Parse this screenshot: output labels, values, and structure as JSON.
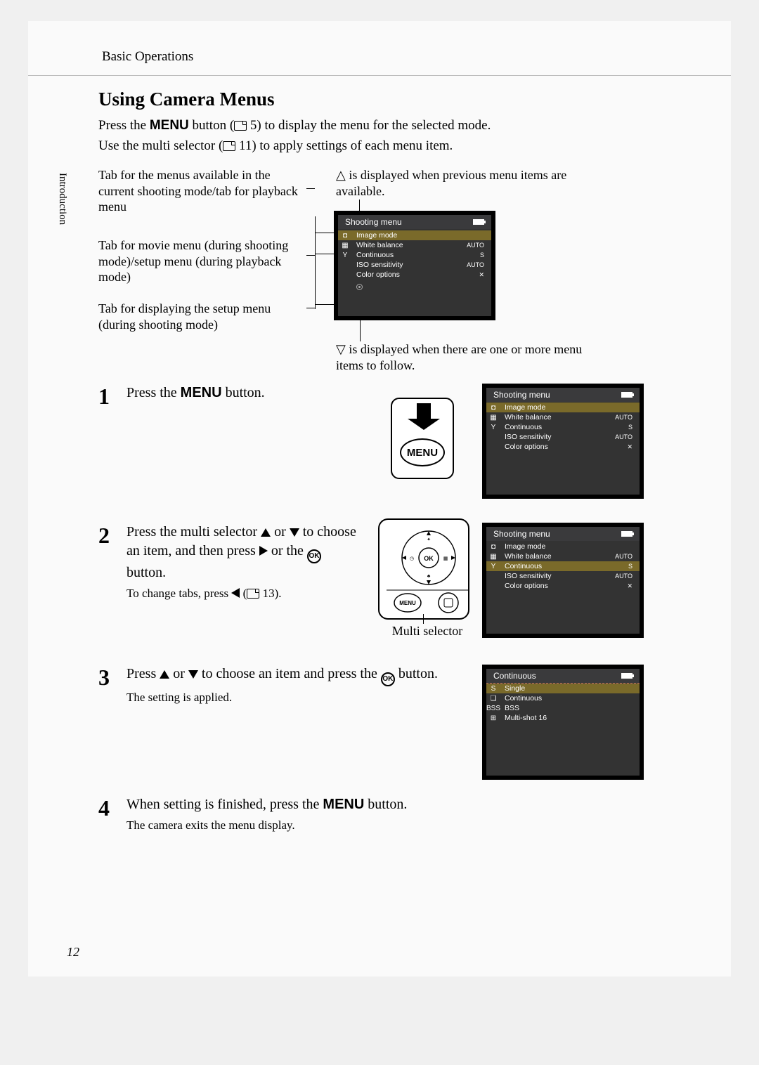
{
  "header": {
    "section": "Basic Operations"
  },
  "sideTab": "Introduction",
  "title": "Using Camera Menus",
  "intro": {
    "line1_a": "Press the ",
    "line1_menu": "MENU",
    "line1_b": " button (",
    "line1_pageRef": " 5) to display the menu for the selected mode.",
    "line2_a": "Use the multi selector (",
    "line2_pageRef": " 11) to apply settings of each menu item."
  },
  "annotations": {
    "leftTop": "Tab for the menus available in the current shooting mode/tab for playback menu",
    "leftMid": "Tab for movie menu (during shooting mode)/setup menu (during playback mode)",
    "leftBot": "Tab for displaying the setup menu (during shooting mode)",
    "rightTop_a": "△ is displayed when previous menu items are available.",
    "bottomRight": "▽ is displayed when there are one or more menu items to follow."
  },
  "screens": {
    "main": {
      "title": "Shooting menu",
      "rows": [
        {
          "label": "Image mode",
          "val": "",
          "icon": "◧"
        },
        {
          "label": "White balance",
          "val": "AUTO"
        },
        {
          "label": "Continuous",
          "val": "S"
        },
        {
          "label": "ISO sensitivity",
          "val": "AUTO"
        },
        {
          "label": "Color options",
          "val": "✕"
        }
      ]
    },
    "step1": {
      "title": "Shooting menu",
      "rows": [
        {
          "label": "Image mode",
          "val": "",
          "icon": "◧"
        },
        {
          "label": "White balance",
          "val": "AUTO"
        },
        {
          "label": "Continuous",
          "val": "S"
        },
        {
          "label": "ISO sensitivity",
          "val": "AUTO"
        },
        {
          "label": "Color options",
          "val": "✕"
        }
      ]
    },
    "step2": {
      "title": "Shooting menu",
      "rows": [
        {
          "label": "Image mode",
          "val": "",
          "icon": "◧"
        },
        {
          "label": "White balance",
          "val": "AUTO"
        },
        {
          "label": "Continuous",
          "val": "S",
          "highlight": true
        },
        {
          "label": "ISO sensitivity",
          "val": "AUTO"
        },
        {
          "label": "Color options",
          "val": "✕"
        }
      ]
    },
    "step3": {
      "title": "Continuous",
      "rows": [
        {
          "label": "Single",
          "icon": "S",
          "highlight": true
        },
        {
          "label": "Continuous",
          "icon": "❏"
        },
        {
          "label": "BSS",
          "icon": "BSS"
        },
        {
          "label": "Multi-shot 16",
          "icon": "⊞"
        }
      ]
    }
  },
  "steps": {
    "s1": {
      "num": "1",
      "title_a": "Press the ",
      "title_menu": "MENU",
      "title_b": " button."
    },
    "s2": {
      "num": "2",
      "title": "Press the multi selector ▲ or ▼ to choose an item, and then press ▶ or the ⊛ button.",
      "title_parts": {
        "a": "Press the multi selector ",
        "b": " or ",
        "c": " to choose an item, and then press ",
        "d": " or the ",
        "e": " button."
      },
      "note_a": "To change tabs, press ",
      "note_b": " (",
      "note_c": " 13).",
      "multiSelectorLabel": "Multi selector"
    },
    "s3": {
      "num": "3",
      "title_parts": {
        "a": "Press ",
        "b": " or ",
        "c": " to choose an item and press the ",
        "d": " button."
      },
      "note": "The setting is applied."
    },
    "s4": {
      "num": "4",
      "title_parts": {
        "a": "When setting is finished, press the ",
        "menu": "MENU",
        "b": " button."
      },
      "note": "The camera exits the menu display."
    }
  },
  "okLabel": "OK",
  "menuLabel": "MENU",
  "pageNumber": "12"
}
